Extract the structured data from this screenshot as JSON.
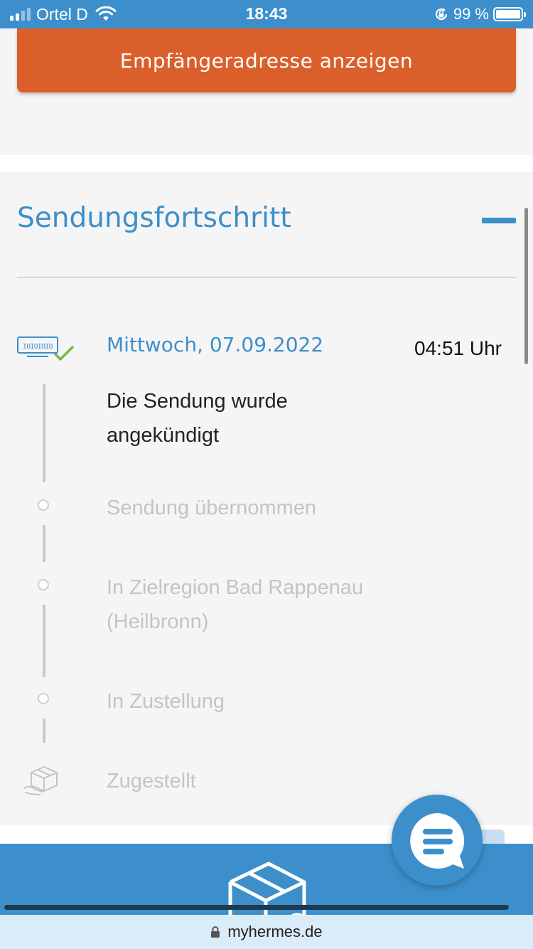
{
  "status_bar": {
    "carrier": "Ortel D",
    "time": "18:43",
    "battery_percent": "99 %",
    "battery_level": 0.99,
    "icons": [
      "signal-icon",
      "wifi-icon",
      "rotation-lock-icon",
      "battery-icon"
    ]
  },
  "recipient": {
    "button_label": "Empfängeradresse anzeigen"
  },
  "progress": {
    "title": "Sendungsfortschritt",
    "collapse_icon": "minus-icon",
    "current_event": {
      "date": "Mittwoch, 07.09.2022",
      "time": "04:51 Uhr",
      "text": "Die Sendung wurde angekündigt",
      "icon": "barcode-check-icon"
    },
    "steps": [
      {
        "label": "Sendung übernommen",
        "icon": "dot-icon"
      },
      {
        "label": "In Zielregion Bad Rappenau (Heilbronn)",
        "icon": "dot-icon"
      },
      {
        "label": "In Zustellung",
        "icon": "dot-icon"
      },
      {
        "label": "Zugestellt",
        "icon": "package-hand-icon"
      }
    ]
  },
  "chat": {
    "icon": "chat-icon"
  },
  "url_bar": {
    "url": "myhermes.de",
    "icon": "lock-icon"
  },
  "colors": {
    "primary_blue": "#3d8fcb",
    "accent_orange": "#db5f2a",
    "check_green": "#7ab648",
    "inactive_gray": "#c4c4c4"
  }
}
